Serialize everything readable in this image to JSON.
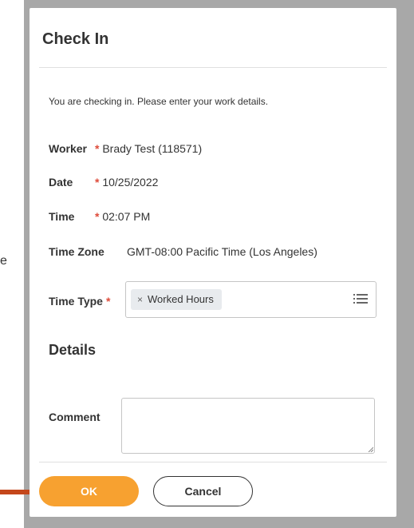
{
  "background": {
    "fragment_text": "e"
  },
  "dialog": {
    "title": "Check In",
    "instruction": "You are checking in.  Please enter your work details.",
    "fields": {
      "worker": {
        "label": "Worker",
        "value": "Brady Test (118571)",
        "required": "*"
      },
      "date": {
        "label": "Date",
        "value": "10/25/2022",
        "required": "*"
      },
      "time": {
        "label": "Time",
        "value": "02:07 PM",
        "required": "*"
      },
      "time_zone": {
        "label": "Time Zone",
        "value": "GMT-08:00 Pacific Time (Los Angeles)"
      },
      "time_type": {
        "label": "Time Type",
        "required": "*",
        "selected": "Worked Hours",
        "remove_glyph": "×"
      }
    },
    "details_heading": "Details",
    "comment": {
      "label": "Comment",
      "value": ""
    },
    "buttons": {
      "ok": "OK",
      "cancel": "Cancel"
    }
  },
  "colors": {
    "accent_orange": "#f7a130",
    "required_red": "#de4b3a",
    "arrow": "#c4471b",
    "overlay": "#a8a8a8"
  },
  "icons": {
    "list": "list-icon",
    "remove": "close-icon",
    "arrow": "arrow-annotation-icon",
    "resize": "resize-grip-icon"
  }
}
